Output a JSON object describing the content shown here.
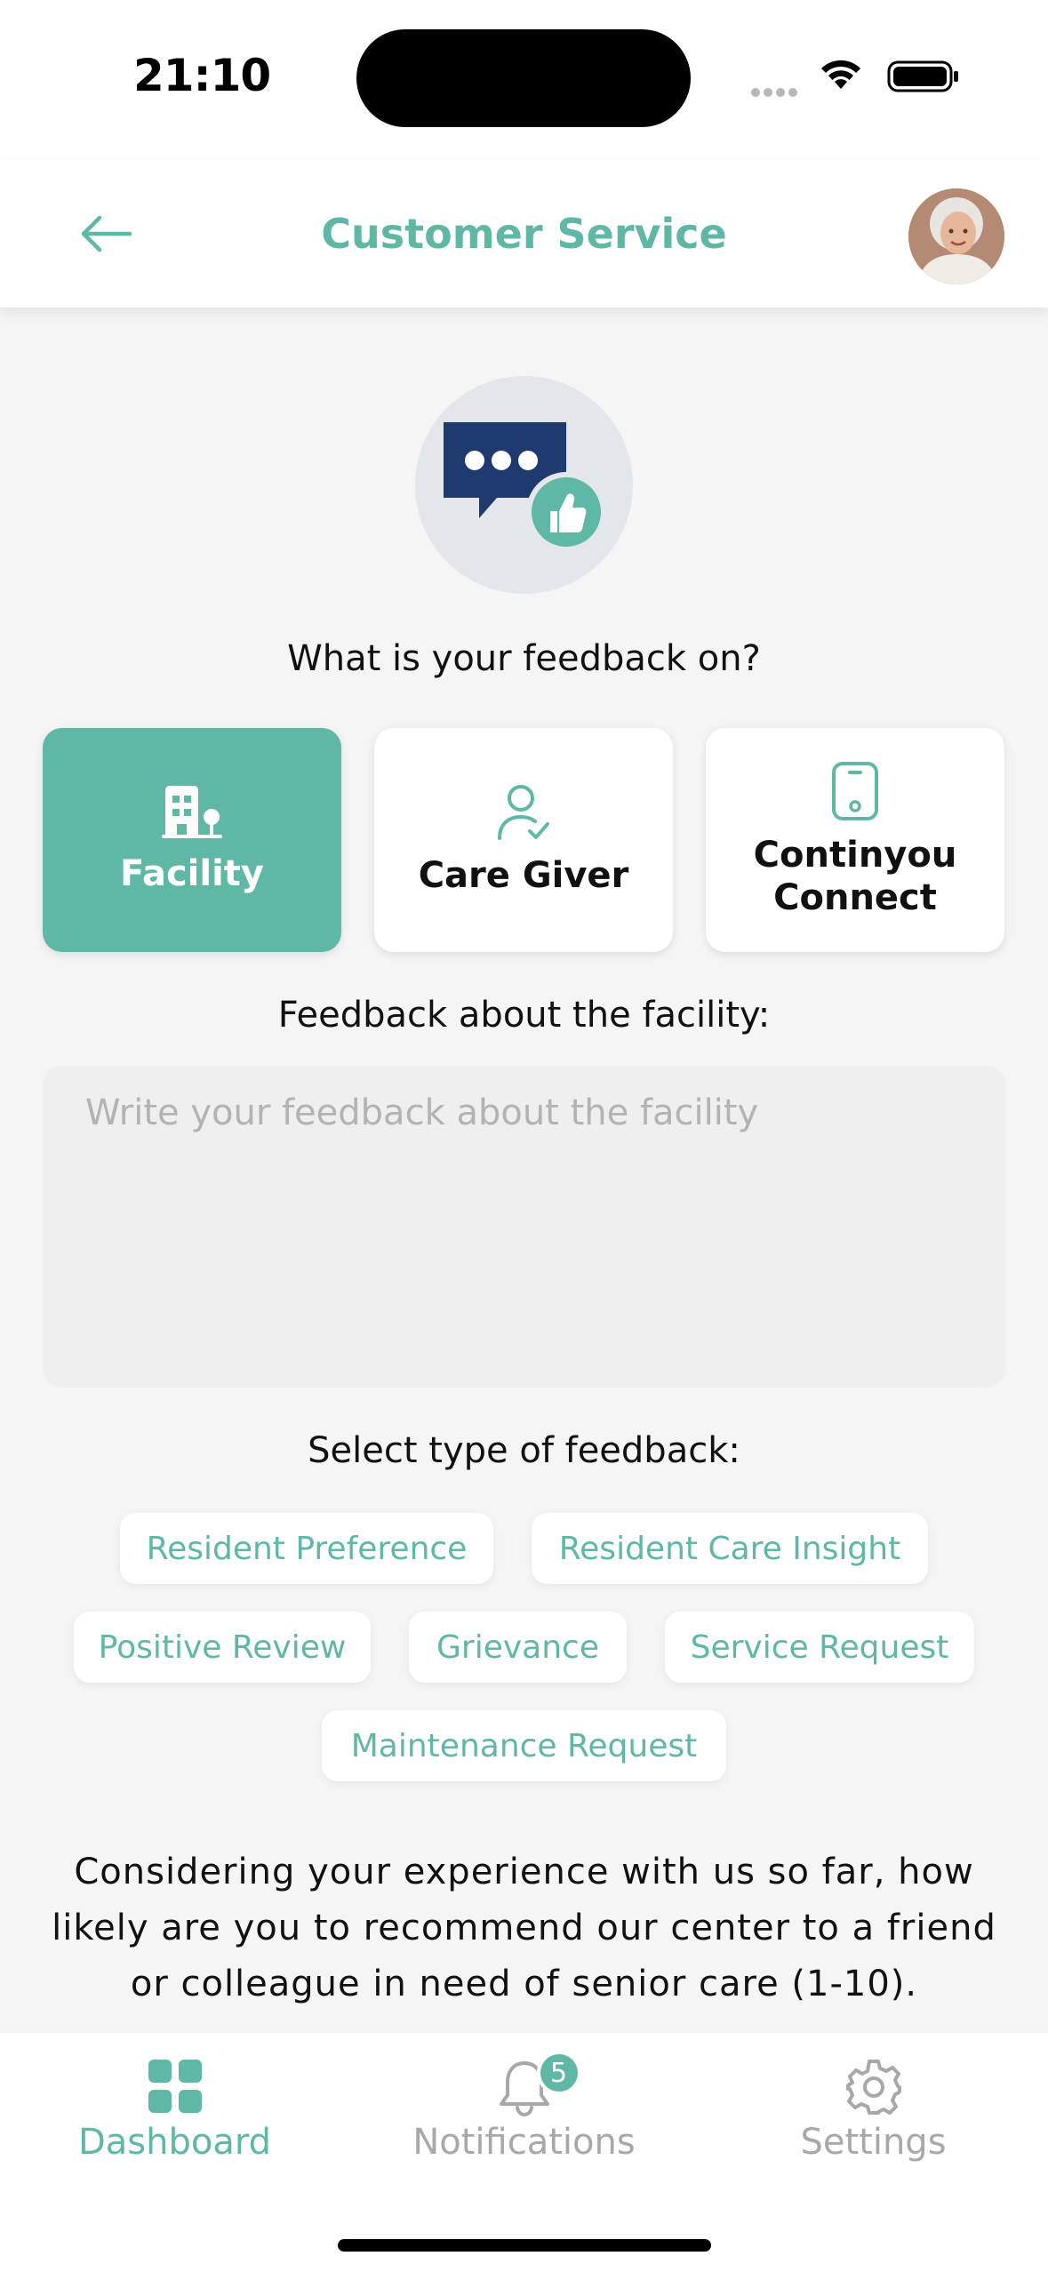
{
  "status_bar": {
    "time": "21:10"
  },
  "header": {
    "title": "Customer Service",
    "back_icon": "arrow-left-icon",
    "avatar_icon": "avatar"
  },
  "colors": {
    "accent": "#5fb8a6",
    "navy": "#1e3a6e",
    "text": "#111111",
    "muted": "#a8a8a8"
  },
  "feedback_question": "What is your feedback on?",
  "categories": [
    {
      "label": "Facility",
      "icon": "building-icon",
      "selected": true
    },
    {
      "label": "Care Giver",
      "icon": "caregiver-icon",
      "selected": false
    },
    {
      "label": "Continyou Connect",
      "icon": "phone-icon",
      "selected": false
    }
  ],
  "feedback_field": {
    "label": "Feedback about the facility:",
    "placeholder": "Write your feedback about the facility",
    "value": ""
  },
  "feedback_types": {
    "label": "Select type of feedback:",
    "options": [
      "Resident Preference",
      "Resident Care Insight",
      "Positive Review",
      "Grievance",
      "Service Request",
      "Maintenance Request"
    ]
  },
  "nps_question": "Considering your experience with us so far, how likely are you to recommend our center to a friend or colleague in need of senior care (1-10).",
  "tab_bar": {
    "tabs": [
      {
        "label": "Dashboard",
        "icon": "dashboard-icon",
        "active": true
      },
      {
        "label": "Notifications",
        "icon": "bell-icon",
        "badge": "5",
        "active": false
      },
      {
        "label": "Settings",
        "icon": "gear-icon",
        "active": false
      }
    ]
  }
}
